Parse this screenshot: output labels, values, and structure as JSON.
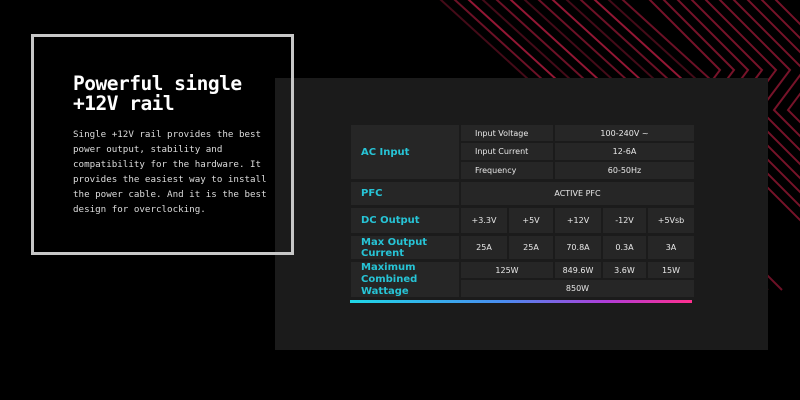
{
  "hero": {
    "title_line1": "Powerful single",
    "title_line2": "+12V rail",
    "desc_lines": [
      "Single +12V rail provides the best",
      "power output, stability and",
      "compatibility for the hardware. It",
      "provides the easiest way to install",
      "the power cable. And it is the best",
      "design for overclocking."
    ]
  },
  "spec": {
    "ac_input": {
      "label": "AC Input",
      "rows": [
        {
          "name": "Input Voltage",
          "value": "100-240V ~"
        },
        {
          "name": "Input Current",
          "value": "12-6A"
        },
        {
          "name": "Frequency",
          "value": "60-50Hz"
        }
      ]
    },
    "pfc": {
      "label": "PFC",
      "value": "ACTIVE PFC"
    },
    "dc_output": {
      "label": "DC Output",
      "values": [
        "+3.3V",
        "+5V",
        "+12V",
        "-12V",
        "+5Vsb"
      ]
    },
    "max_current": {
      "label": "Max Output Current",
      "values": [
        "25A",
        "25A",
        "70.8A",
        "0.3A",
        "3A"
      ]
    },
    "max_wattage": {
      "label": "Maximum Combined Wattage",
      "values": [
        "125W",
        "849.6W",
        "3.6W",
        "15W"
      ],
      "total": "850W"
    }
  },
  "colors": {
    "accent": "#27c4d6",
    "stripe": "#e8204f",
    "panel": "#1b1b1b",
    "cell": "#262626"
  }
}
